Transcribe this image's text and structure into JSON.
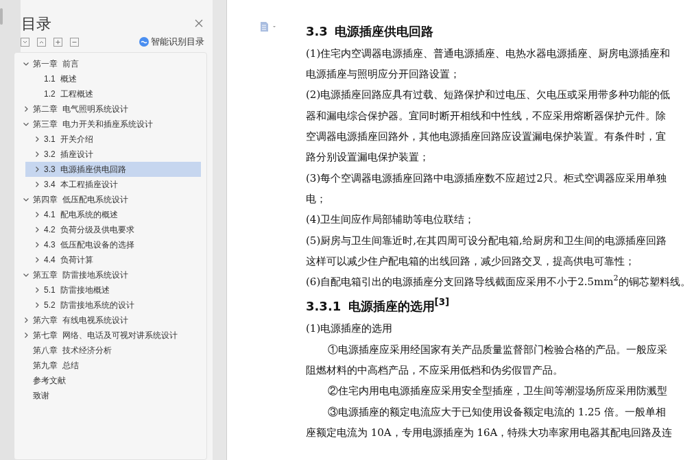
{
  "toc_panel": {
    "title": "目录",
    "smart_toc_label": "智能识别目录",
    "items": [
      {
        "label": "第一章 前言",
        "expanded": true,
        "selected": false,
        "children": [
          {
            "label": "1.1 概述",
            "selected": false
          },
          {
            "label": "1.2 工程概述",
            "selected": false
          }
        ]
      },
      {
        "label": "第二章 电气照明系统设计",
        "expanded": false,
        "selected": false
      },
      {
        "label": "第三章 电力开关和插座系统设计",
        "expanded": true,
        "selected": false,
        "children": [
          {
            "label": "3.1 开关介绍",
            "expanded": false,
            "selected": false
          },
          {
            "label": "3.2 插座设计",
            "expanded": false,
            "selected": false
          },
          {
            "label": "3.3 电源插座供电回路",
            "expanded": false,
            "selected": true
          },
          {
            "label": "3.4 本工程插座设计",
            "expanded": false,
            "selected": false
          }
        ]
      },
      {
        "label": "第四章 低压配电系统设计",
        "expanded": true,
        "selected": false,
        "children": [
          {
            "label": "4.1 配电系统的概述",
            "expanded": false,
            "selected": false
          },
          {
            "label": "4.2 负荷分级及供电要求",
            "expanded": false,
            "selected": false
          },
          {
            "label": "4.3 低压配电设备的选择",
            "expanded": false,
            "selected": false
          },
          {
            "label": "4.4 负荷计算",
            "expanded": false,
            "selected": false
          }
        ]
      },
      {
        "label": "第五章 防雷接地系统设计",
        "expanded": true,
        "selected": false,
        "children": [
          {
            "label": "5.1 防雷接地概述",
            "expanded": false,
            "selected": false
          },
          {
            "label": "5.2 防雷接地系统的设计",
            "expanded": false,
            "selected": false
          }
        ]
      },
      {
        "label": "第六章 有线电视系统设计",
        "expanded": false,
        "selected": false
      },
      {
        "label": "第七章 网络、电话及可视对讲系统设计",
        "expanded": false,
        "selected": false
      },
      {
        "label": "第八章 技术经济分析",
        "selected": false
      },
      {
        "label": "第九章 总结",
        "selected": false
      },
      {
        "label": "参考文献",
        "selected": false
      },
      {
        "label": "致谢",
        "selected": false
      }
    ]
  },
  "document": {
    "blocks": [
      {
        "kind": "heading",
        "text": "3.3 电源插座供电回路"
      },
      {
        "kind": "line",
        "text": "(1)住宅内空调器电源插座、普通电源插座、电热水器电源插座、厨房电源插座和"
      },
      {
        "kind": "line",
        "text": "电源插座与照明应分开回路设置；"
      },
      {
        "kind": "line",
        "text": "(2)电源插座回路应具有过载、短路保护和过电压、欠电压或采用带多种功能的低"
      },
      {
        "kind": "line",
        "text": "器和漏电综合保护器。宜同时断开相线和中性线，不应采用熔断器保护元件。除"
      },
      {
        "kind": "line",
        "text": "空调器电源插座回路外，其他电源插座回路应设置漏电保护装置。有条件时，宜"
      },
      {
        "kind": "line",
        "text": "路分别设置漏电保护装置；"
      },
      {
        "kind": "line",
        "text": "(3)每个空调器电源插座回路中电源插座数不应超过2只。柜式空调器应采用单独"
      },
      {
        "kind": "line",
        "text": "电；"
      },
      {
        "kind": "line",
        "text": "(4)卫生间应作局部辅助等电位联结；"
      },
      {
        "kind": "line",
        "text": "(5)厨房与卫生间靠近时,在其四周可设分配电箱,给厨房和卫生间的电源插座回路"
      },
      {
        "kind": "line",
        "text": "这样可以减少住户配电箱的出线回路，减少回路交叉，提高供电可靠性；"
      },
      {
        "kind": "line",
        "text": "(6)自配电箱引出的电源插座分支回路导线截面应采用不小于2.5mm$^{2}$的铜芯塑料线。"
      },
      {
        "kind": "heading",
        "text": "3.3.1 电源插座的选用$^{[3]}$"
      },
      {
        "kind": "line",
        "text": "(1)电源插座的选用"
      },
      {
        "kind": "indent",
        "text": "①电源插座应采用经国家有关产品质量监督部门检验合格的产品。一般应采"
      },
      {
        "kind": "line",
        "text": "阻燃材料的中高档产品，不应采用低档和伪劣假冒产品。"
      },
      {
        "kind": "indent",
        "text": "②住宅内用电电源插座应采用安全型插座，卫生间等潮湿场所应采用防溅型"
      },
      {
        "kind": "indent",
        "text": "③电源插座的额定电流应大于已知使用设备额定电流的 1.25 倍。一般单相"
      },
      {
        "kind": "line",
        "text": "座额定电流为 10A，专用电源插座为 16A，特殊大功率家用电器其配电回路及连"
      }
    ]
  }
}
